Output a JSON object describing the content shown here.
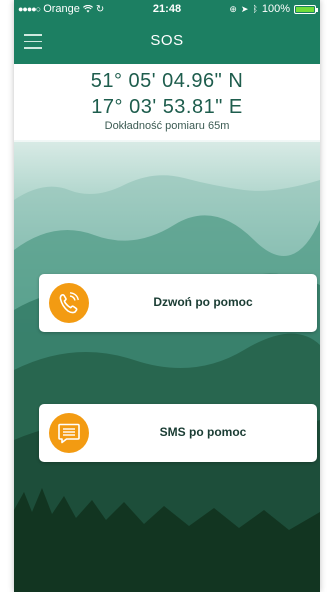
{
  "status_bar": {
    "carrier": "Orange",
    "time": "21:48",
    "battery": "100%"
  },
  "nav": {
    "title": "SOS"
  },
  "location": {
    "latitude": "51° 05' 04.96\" N",
    "longitude": "17° 03' 53.81\" E",
    "accuracy": "Dokładność pomiaru 65m"
  },
  "actions": {
    "call_label": "Dzwoń po pomoc",
    "sms_label": "SMS po pomoc"
  },
  "colors": {
    "primary": "#1c7f62",
    "accent": "#f39b12",
    "text": "#1e5d4d"
  },
  "icons": {
    "menu": "hamburger-icon",
    "call": "phone-call-icon",
    "sms": "message-icon"
  }
}
